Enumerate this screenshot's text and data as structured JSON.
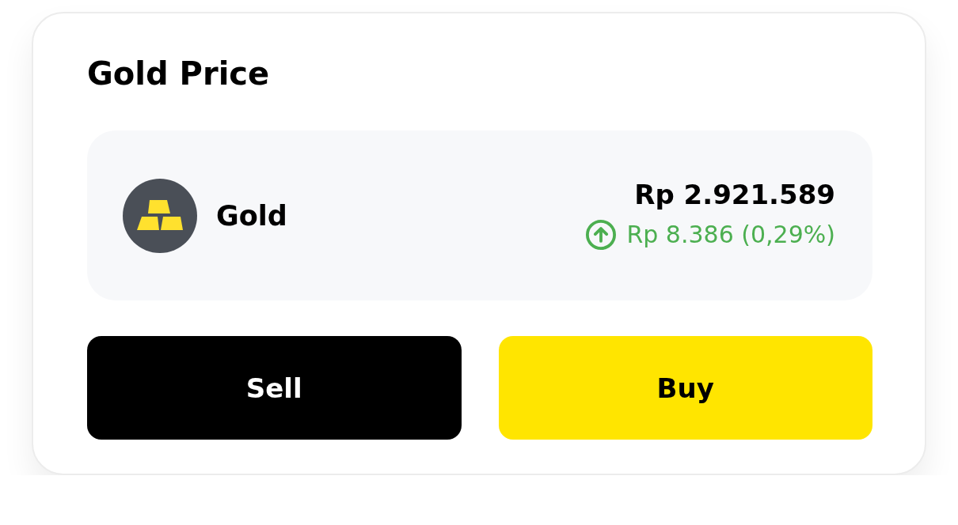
{
  "card": {
    "title": "Gold Price"
  },
  "asset": {
    "name": "Gold",
    "price": "Rp 2.921.589",
    "change": {
      "rising": true,
      "text": "Rp 8.386 (0,29%)"
    }
  },
  "buttons": [
    {
      "label": "Sell",
      "kind": "sell"
    },
    {
      "label": "Buy",
      "kind": "buy"
    }
  ]
}
